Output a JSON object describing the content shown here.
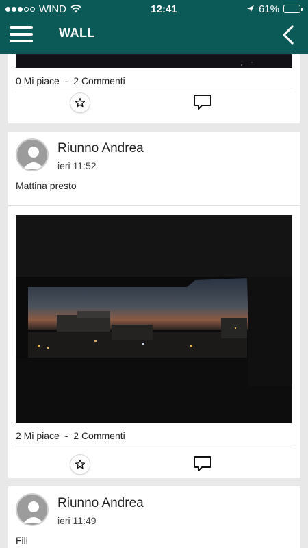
{
  "status_bar": {
    "carrier": "WIND",
    "time": "12:41",
    "battery": "61%",
    "battery_level": 0.61
  },
  "header": {
    "title": "WALL",
    "menu_icon": "hamburger-icon",
    "back_icon": "chevron-left-icon"
  },
  "colors": {
    "header_bg": "#0c5a57",
    "page_bg": "#e8e8e8",
    "card_bg": "#ffffff"
  },
  "posts": [
    {
      "likes_label": "0 Mi piace",
      "comments_label": "2 Commenti",
      "separator": "-"
    },
    {
      "author": "Riunno Andrea",
      "time": "ieri 11:52",
      "text": "Mattina presto",
      "likes_label": "2 Mi piace",
      "comments_label": "2 Commenti",
      "separator": "-"
    },
    {
      "author": "Riunno Andrea",
      "time": "ieri 11:49",
      "text": "Fili"
    }
  ]
}
